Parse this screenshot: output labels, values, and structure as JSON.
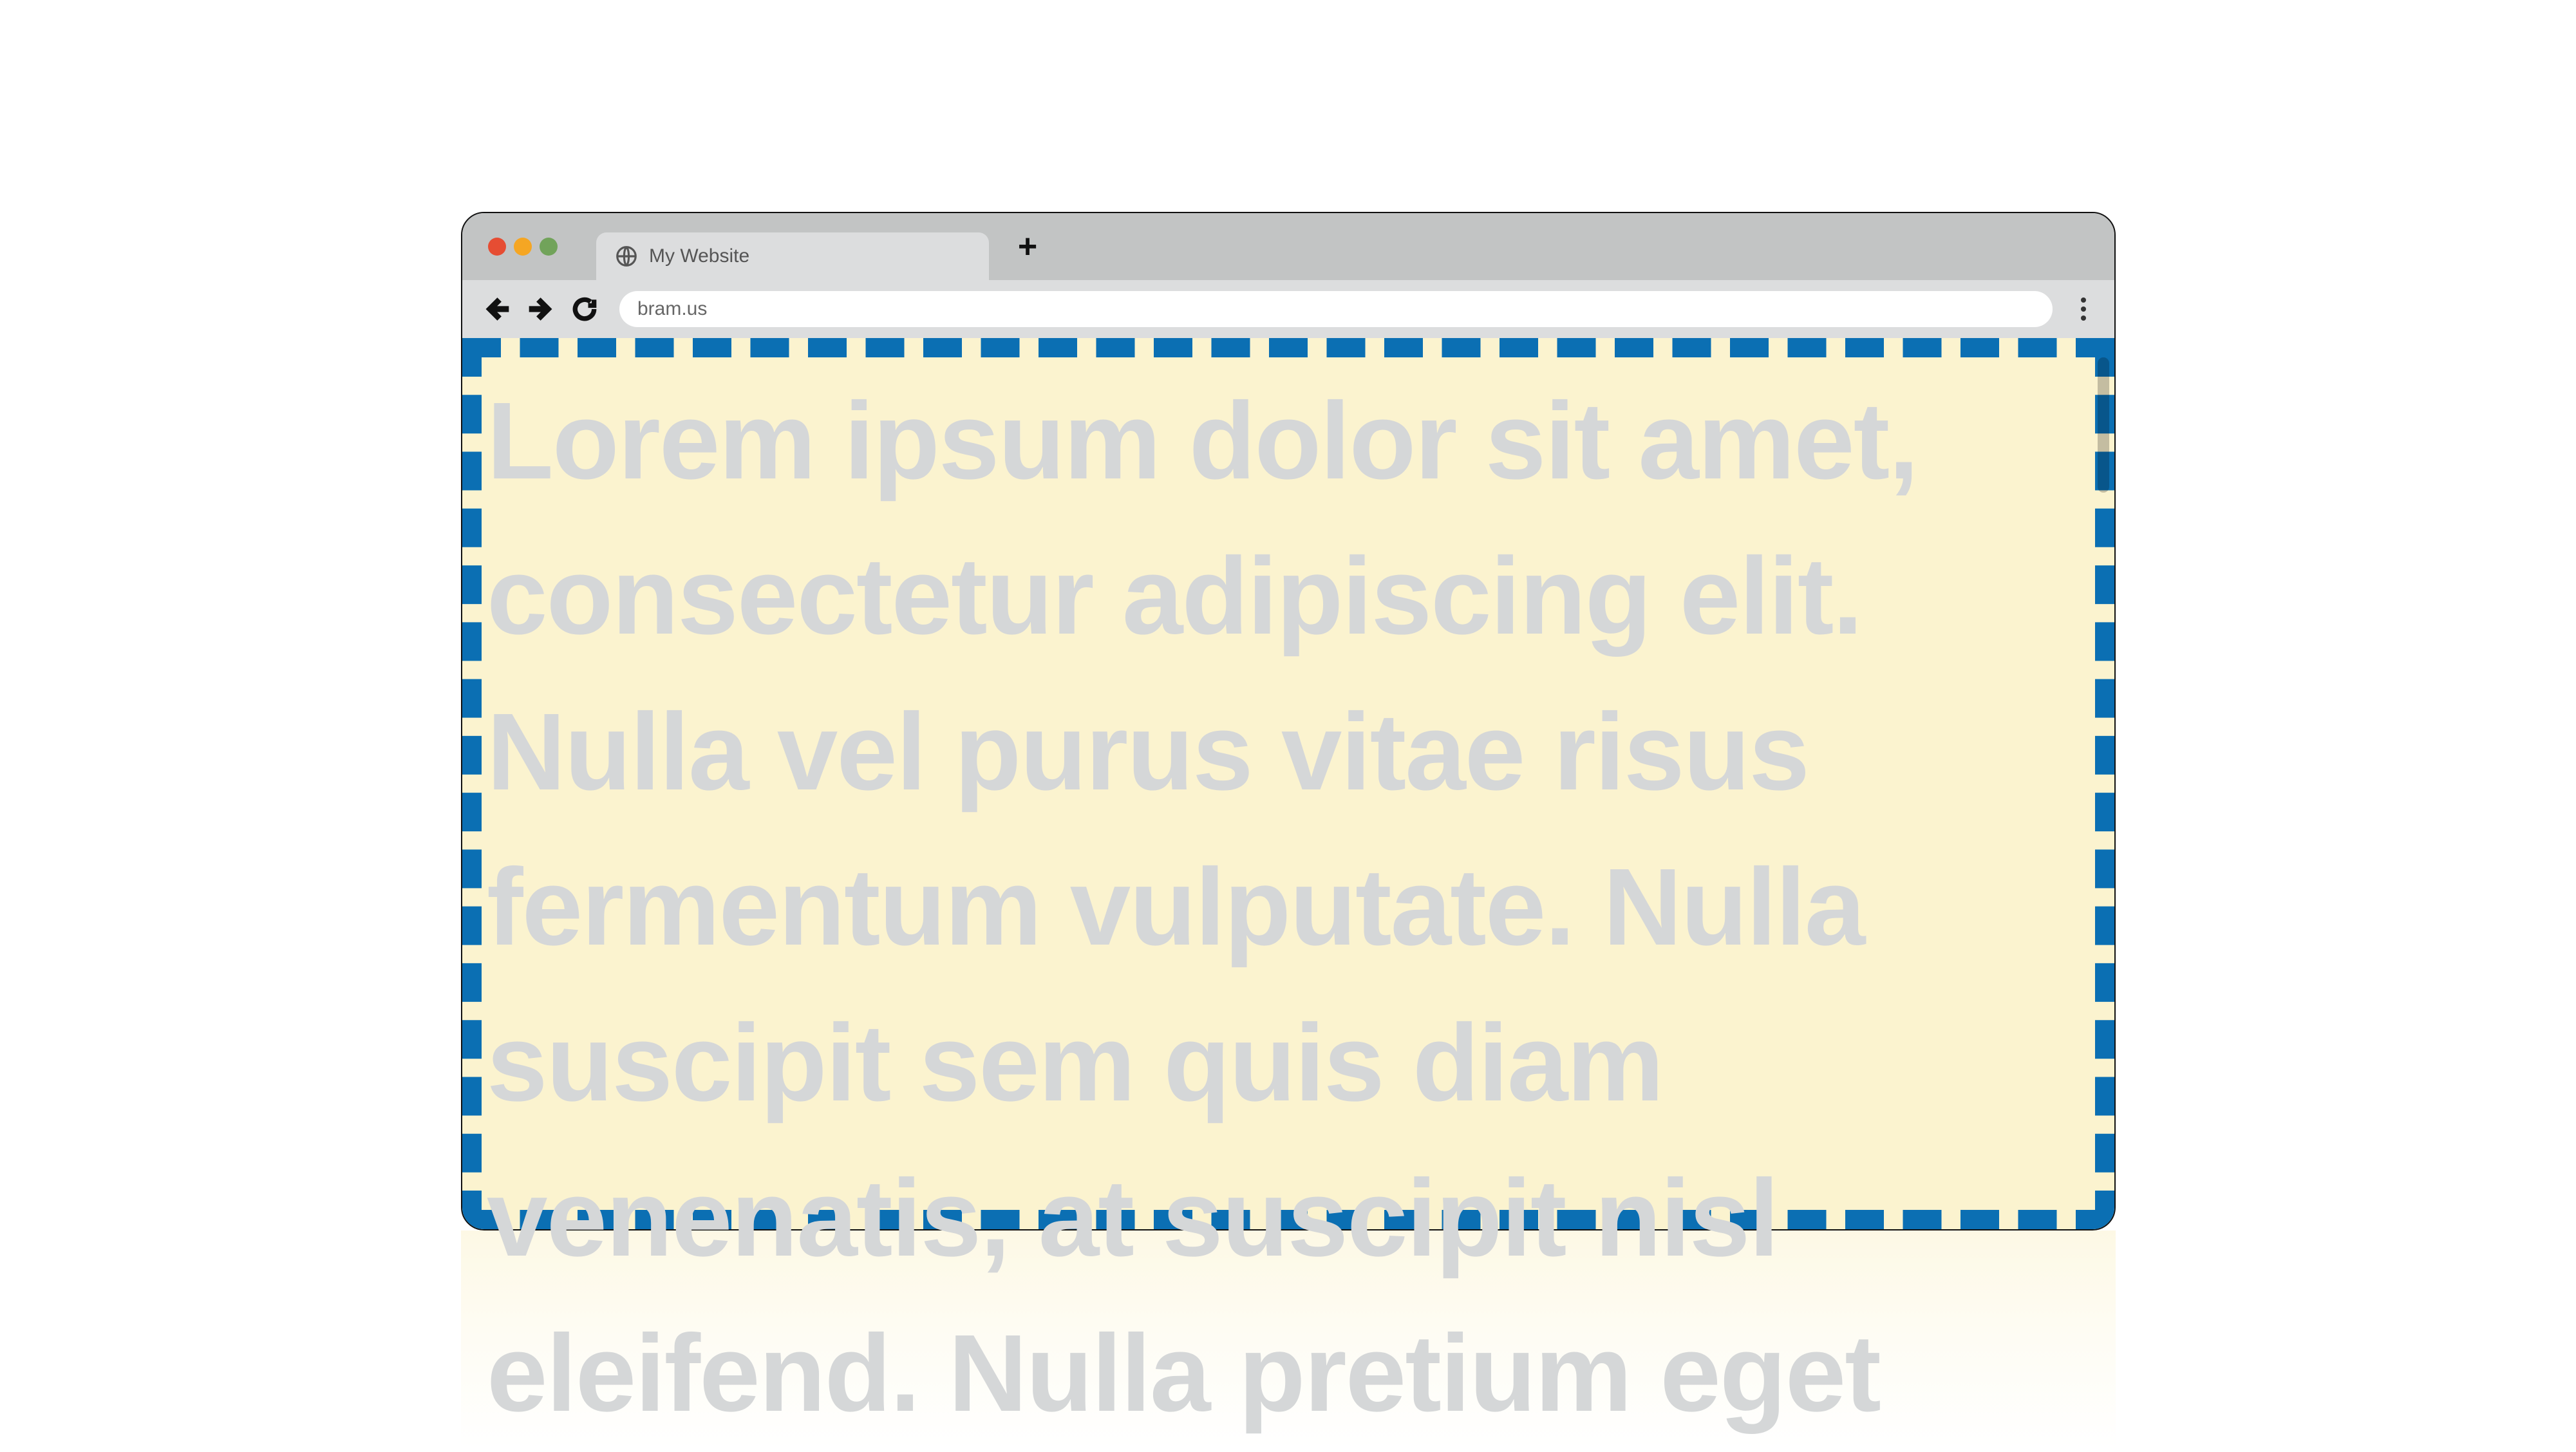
{
  "tab": {
    "title": "My Website"
  },
  "address_bar": {
    "url": "bram.us"
  },
  "page": {
    "body_text": "Lorem ipsum dolor sit amet, consectetur adipiscing elit. Nulla vel purus vitae risus fermentum vulputate. Nulla suscipit sem quis diam venenatis, at suscipit nisl eleifend. Nulla pretium eget"
  },
  "colors": {
    "page_bg": "#fbf3cf",
    "viewport_dash": "#0b6fb3",
    "chrome_tabstrip": "#c2c4c4",
    "chrome_toolbar": "#dcddde",
    "text_placeholder": "#d5d7d8"
  }
}
